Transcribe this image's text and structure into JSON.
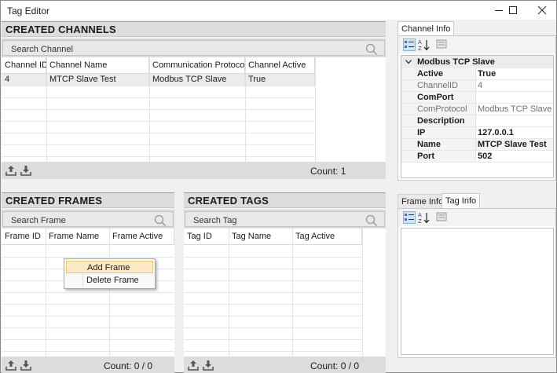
{
  "window": {
    "title": "Tag Editor"
  },
  "channels": {
    "title": "CREATED CHANNELS",
    "search_placeholder": "Search Channel",
    "columns": [
      "Channel ID",
      "Channel Name",
      "Communication Protocol",
      "Channel Active"
    ],
    "rows": [
      [
        "4",
        "MTCP Slave Test",
        "Modbus TCP Slave",
        "True"
      ]
    ],
    "count_label": "Count: 1"
  },
  "frames": {
    "title": "CREATED FRAMES",
    "search_placeholder": "Search Frame",
    "columns": [
      "Frame ID",
      "Frame Name",
      "Frame Active"
    ],
    "count_label": "Count: 0 / 0"
  },
  "tags": {
    "title": "CREATED TAGS",
    "search_placeholder": "Search Tag",
    "columns": [
      "Tag ID",
      "Tag Name",
      "Tag Active"
    ],
    "count_label": "Count: 0 / 0"
  },
  "context_menu": {
    "items": [
      "Add Frame",
      "Delete Frame"
    ]
  },
  "channel_info": {
    "tab": "Channel Info",
    "category": "Modbus TCP Slave",
    "properties": [
      {
        "name": "Active",
        "value": "True"
      },
      {
        "name": "ChannelID",
        "value": "4"
      },
      {
        "name": "ComPort",
        "value": ""
      },
      {
        "name": "ComProtocol",
        "value": "Modbus TCP Slave"
      },
      {
        "name": "Description",
        "value": ""
      },
      {
        "name": "IP",
        "value": "127.0.0.1"
      },
      {
        "name": "Name",
        "value": "MTCP Slave Test"
      },
      {
        "name": "Port",
        "value": "502"
      }
    ]
  },
  "lower_info": {
    "tabs": [
      "Frame Info",
      "Tag Info"
    ]
  },
  "colors": {
    "header_bg": "#dcdcdc",
    "selected_row": "#ececec",
    "toggle_on": "#cfe3f6",
    "menu_highlight": "#fbe9c3"
  }
}
